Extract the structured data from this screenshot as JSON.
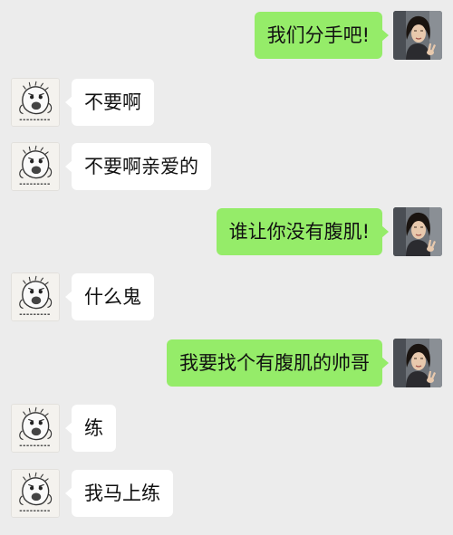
{
  "conversation": {
    "messages": [
      {
        "side": "right",
        "avatar": "woman-photo-avatar",
        "text": "我们分手吧!"
      },
      {
        "side": "left",
        "avatar": "meme-sketch-avatar",
        "text": "不要啊"
      },
      {
        "side": "left",
        "avatar": "meme-sketch-avatar",
        "text": "不要啊亲爱的"
      },
      {
        "side": "right",
        "avatar": "woman-photo-avatar",
        "text": "谁让你没有腹肌!"
      },
      {
        "side": "left",
        "avatar": "meme-sketch-avatar",
        "text": "什么鬼"
      },
      {
        "side": "right",
        "avatar": "woman-photo-avatar",
        "text": "我要找个有腹肌的帅哥"
      },
      {
        "side": "left",
        "avatar": "meme-sketch-avatar",
        "text": "练"
      },
      {
        "side": "left",
        "avatar": "meme-sketch-avatar",
        "text": "我马上练"
      }
    ]
  },
  "colors": {
    "background": "#ececec",
    "sent_bubble": "#95ec69",
    "received_bubble": "#ffffff"
  }
}
